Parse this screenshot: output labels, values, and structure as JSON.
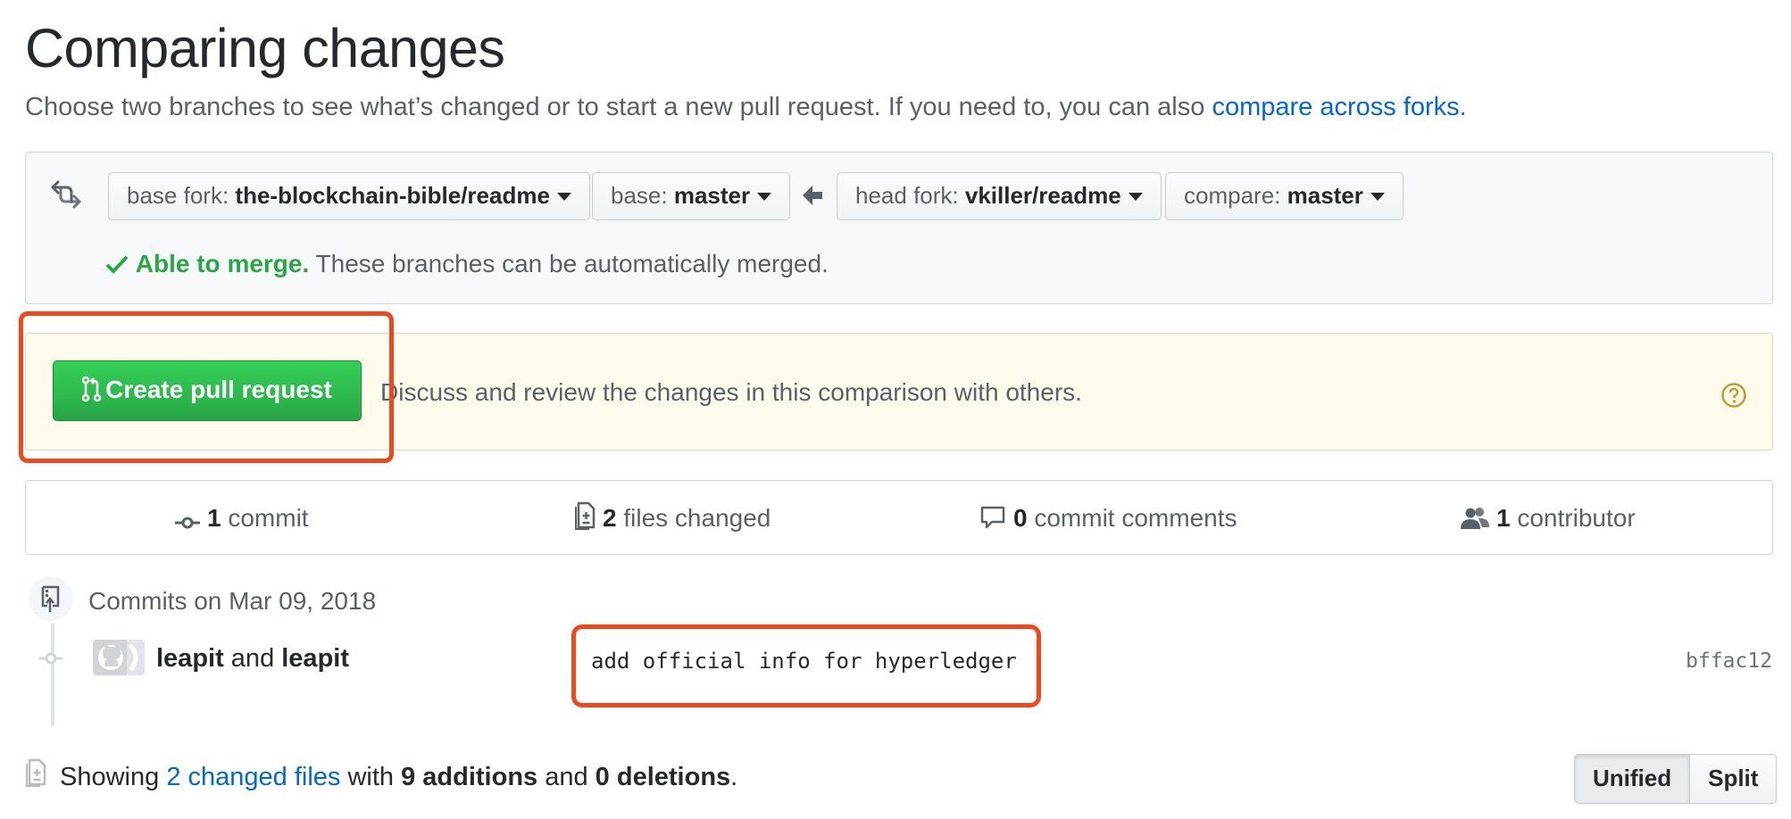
{
  "page": {
    "title": "Comparing changes",
    "subtitle_text": "Choose two branches to see what’s changed or to start a new pull request. If you need to, you can also ",
    "subtitle_link": "compare across forks",
    "subtitle_end": "."
  },
  "range": {
    "base_fork_label": "base fork: ",
    "base_fork_value": "the-blockchain-bible/readme",
    "base_label": "base: ",
    "base_value": "master",
    "head_fork_label": "head fork: ",
    "head_fork_value": "vkiller/readme",
    "compare_label": "compare: ",
    "compare_value": "master",
    "merge_status": "Able to merge.",
    "merge_text": " These branches can be automatically merged."
  },
  "pull_request": {
    "button_label": "Create pull request",
    "description": "Discuss and review the changes in this comparison with others."
  },
  "stats": {
    "commits_count": "1",
    "commits_label": " commit",
    "files_count": "2",
    "files_label": " files changed",
    "comments_count": "0",
    "comments_label": " commit comments",
    "contributors_count": "1",
    "contributors_label": " contributor"
  },
  "commits": {
    "date_heading": "Commits on Mar 09, 2018",
    "items": [
      {
        "author1": "leapit",
        "joiner": " and ",
        "author2": "leapit",
        "message": "add official info for hyperledger",
        "sha": "bffac12"
      }
    ]
  },
  "summary": {
    "showing": "Showing ",
    "files_link": "2 changed files",
    "with": " with ",
    "additions": "9 additions",
    "and": " and ",
    "deletions": "0 deletions",
    "end": "."
  },
  "view_toggle": {
    "unified": "Unified",
    "split": "Split"
  },
  "colors": {
    "primary_button": "#28a745",
    "link": "#0366d6",
    "highlight": "#f1471d",
    "merge_ok": "#28a745"
  },
  "icons": [
    "git-compare-icon",
    "arrow-left-icon",
    "check-icon",
    "git-pull-request-icon",
    "question-icon",
    "git-commit-icon",
    "file-diff-icon",
    "comment-icon",
    "people-icon",
    "repo-push-icon",
    "avatar-icon",
    "file-icon",
    "caret-down-icon"
  ]
}
